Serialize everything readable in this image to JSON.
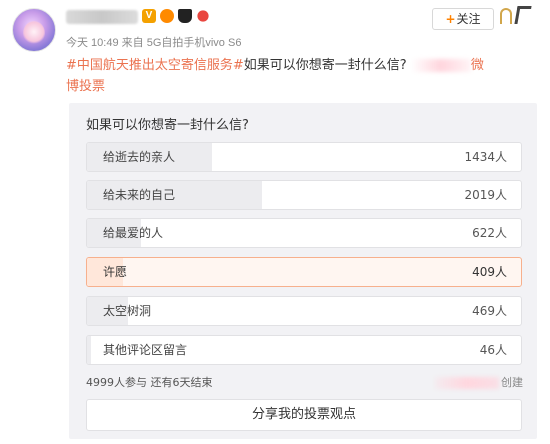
{
  "post": {
    "author_badges": [
      "V",
      "",
      "",
      ""
    ],
    "meta": "今天 10:49 来自 5G自拍手机vivo S6",
    "follow_label": "关注",
    "follow_plus": "+",
    "caption_tag": "#中国航天推出太空寄信服务#",
    "caption_text": "如果可以你想寄一封什么信?",
    "caption_tail_a": "微",
    "caption_tail_b": "博投票"
  },
  "poll": {
    "title": "如果可以你想寄一封什么信?",
    "options": [
      {
        "label": "给逝去的亲人",
        "count": "1434人",
        "fraction": 0.287,
        "selected": false
      },
      {
        "label": "给未来的自己",
        "count": "2019人",
        "fraction": 0.404,
        "selected": false
      },
      {
        "label": "给最爱的人",
        "count": "622人",
        "fraction": 0.124,
        "selected": false
      },
      {
        "label": "许愿",
        "count": "409人",
        "fraction": 0.082,
        "selected": true
      },
      {
        "label": "太空树洞",
        "count": "469人",
        "fraction": 0.094,
        "selected": false
      },
      {
        "label": "其他评论区留言",
        "count": "46人",
        "fraction": 0.009,
        "selected": false
      }
    ],
    "summary": "4999人参与  还有6天结束",
    "creator_suffix": "创建",
    "share_label": "分享我的投票观点"
  },
  "colors": {
    "accent": "#eb7350",
    "selected_border": "#f7b08d",
    "poll_bg": "#f2f2f5"
  }
}
